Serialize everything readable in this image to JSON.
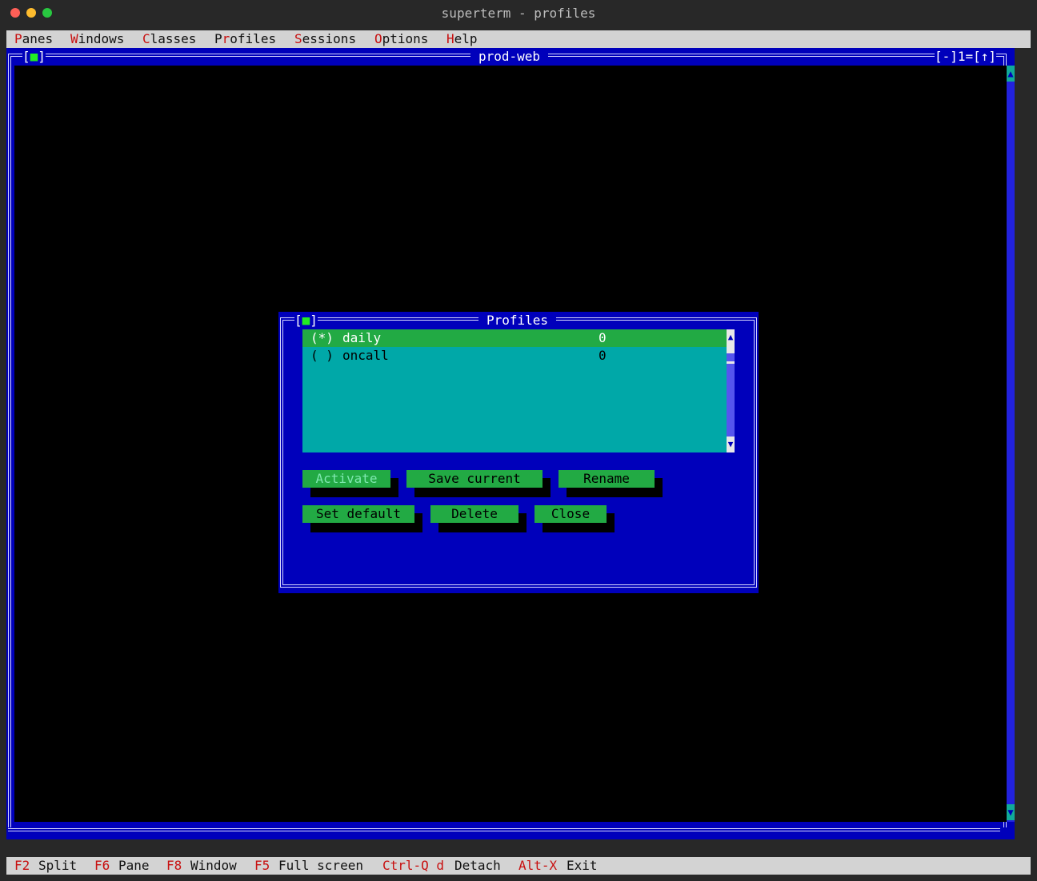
{
  "window": {
    "title": "superterm - profiles",
    "controls": [
      "close",
      "minimize",
      "maximize"
    ]
  },
  "menubar": {
    "items": [
      {
        "hot": "P",
        "rest": "anes"
      },
      {
        "hot": "W",
        "rest": "indows"
      },
      {
        "hot": "C",
        "rest": "lasses"
      },
      {
        "pre": "P",
        "hot": "r",
        "rest": "ofiles"
      },
      {
        "hot": "S",
        "rest": "essions"
      },
      {
        "hot": "O",
        "rest": "ptions"
      },
      {
        "hot": "H",
        "rest": "elp"
      }
    ]
  },
  "pane": {
    "title": "prod-web",
    "close_box_left": "[",
    "close_box_mark": "■",
    "close_box_right": "]",
    "right_controls": "[-]1=[↑]",
    "scroll_up": "▲",
    "scroll_down": "▼"
  },
  "dialog": {
    "title": "Profiles",
    "close_box_left": "[",
    "close_box_mark": "■",
    "close_box_right": "]",
    "list": {
      "rows": [
        {
          "marker": "(*)",
          "name": "daily",
          "count": "0",
          "selected": true
        },
        {
          "marker": "( )",
          "name": "oncall",
          "count": "0",
          "selected": false
        }
      ],
      "scroll_up": "▲",
      "scroll_down": "▼"
    },
    "buttons": {
      "activate": "Activate",
      "save_current": "Save current",
      "rename": "Rename",
      "set_default": "Set default",
      "delete": "Delete",
      "close": "Close"
    }
  },
  "statusbar": {
    "items": [
      {
        "key": "F2",
        "label": "Split"
      },
      {
        "key": "F6",
        "label": "Pane"
      },
      {
        "key": "F8",
        "label": "Window"
      },
      {
        "key": "F5",
        "label": "Full screen"
      },
      {
        "key": "Ctrl-Q d",
        "label": "Detach"
      },
      {
        "key": "Alt-X",
        "label": "Exit"
      }
    ]
  },
  "colors": {
    "desktop_blue": "#0000bb",
    "selection_green": "#22aa44",
    "list_cyan": "#00a8a8",
    "hotkey_red": "#c81010"
  }
}
